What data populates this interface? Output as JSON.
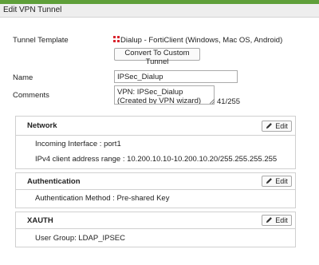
{
  "dialog": {
    "title": "Edit VPN Tunnel"
  },
  "accent_color": "#5f9f3a",
  "tunnel_template": {
    "label": "Tunnel Template",
    "icon": "fortinet-logo-icon",
    "value": "Dialup - FortiClient (Windows, Mac OS, Android)",
    "convert_button": "Convert To Custom Tunnel"
  },
  "name": {
    "label": "Name",
    "value": "IPSec_Dialup"
  },
  "comments": {
    "label": "Comments",
    "value": "VPN: IPSec_Dialup (Created by VPN wizard)",
    "counter": "41/255"
  },
  "sections": [
    {
      "title": "Network",
      "edit_label": "Edit",
      "rows": [
        "Incoming Interface : port1",
        "IPv4 client address range : 10.200.10.10-10.200.10.20/255.255.255.255"
      ]
    },
    {
      "title": "Authentication",
      "edit_label": "Edit",
      "rows": [
        "Authentication Method : Pre-shared Key"
      ]
    },
    {
      "title": "XAUTH",
      "edit_label": "Edit",
      "rows": [
        "User Group: LDAP_IPSEC"
      ]
    }
  ]
}
